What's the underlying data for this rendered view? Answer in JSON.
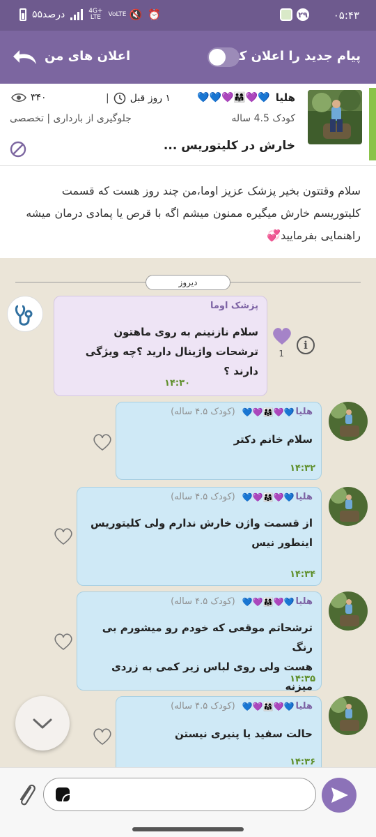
{
  "status_bar": {
    "time": "۰۵:۴۳",
    "notification_count": "۲۹",
    "battery_text": "۵۵درصد",
    "network_top": "4G+",
    "network_bottom": "LTE",
    "volte": "VoLTE"
  },
  "header": {
    "new_message_label": "پیام جدید را اعلان کن",
    "my_notifications_label": "اعلان های من",
    "toggle_on": false
  },
  "question": {
    "username": "هلیا",
    "age": "کودک 4.5 ساله",
    "title": "خارش در کلیتوریس ...",
    "time_ago": "۱ روز قبل",
    "views": "۳۴۰",
    "category": "جلوگیری از بارداری | تخصصی",
    "body": "سلام وقتتون بخیر پزشک عزیز اوما،من چند روز هست که قسمت کلیتوریسم خارش میگیره ممنون میشم اگه با قرص یا پمادی درمان میشه راهنمایی بفرمایید💞"
  },
  "chat": {
    "date_label": "دیروز",
    "doctor_message": {
      "sender": "پزشک اوما",
      "text_line1": "سلام نازنینم به روی ماهتون",
      "text_line2": "ترشحات واژینال دارید ؟چه ویژگی دارند ؟",
      "time": "۱۴:۳۰",
      "like_count": "1"
    },
    "user_messages": [
      {
        "sender": "هلیا",
        "age": "(کودک ۴.۵ ساله)",
        "text_line1": "سلام خانم دکتر",
        "text_line2": "",
        "time": "۱۴:۳۲"
      },
      {
        "sender": "هلیا",
        "age": "(کودک ۴.۵ ساله)",
        "text_line1": "از قسمت واژن خارش ندارم ولی کلیتوریس",
        "text_line2": "اینطور نیس",
        "time": "۱۴:۳۴"
      },
      {
        "sender": "هلیا",
        "age": "(کودک ۴.۵ ساله)",
        "text_line1": "ترشحاتم موقعی که خودم رو میشورم بی رنگ",
        "text_line2": "هست ولی روی لباس زیر کمی به زردی میزنه",
        "time": "۱۴:۳۵"
      },
      {
        "sender": "هلیا",
        "age": "(کودک ۴.۵ ساله)",
        "text_line1": "حالت سفید یا پنیری نیستن",
        "text_line2": "",
        "time": "۱۴:۳۶"
      }
    ]
  },
  "input": {
    "placeholder": ""
  },
  "colors": {
    "header": "#7c66a0",
    "doctor_bubble": "#eee4f5",
    "user_bubble": "#cfe9f6",
    "time_green": "#5f8f2b",
    "accent_purple": "#8c72b8"
  },
  "icons": {
    "back": "back-arrow-icon",
    "views": "eye-icon",
    "time": "clock-icon",
    "block": "block-icon",
    "info": "info-icon",
    "heart": "heart-icon",
    "send": "send-icon",
    "attach": "paperclip-icon",
    "scroll": "chevron-down-icon"
  }
}
